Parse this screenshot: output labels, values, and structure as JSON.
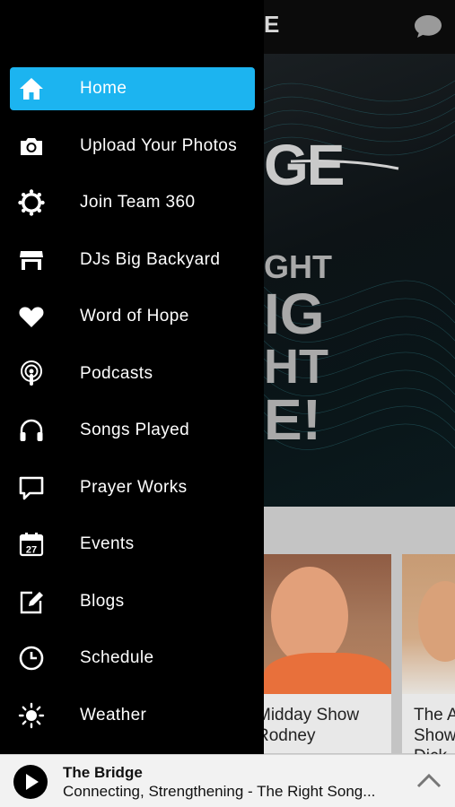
{
  "menu": {
    "items": [
      {
        "label": "Home",
        "icon": "home-icon",
        "active": true
      },
      {
        "label": "Upload Your Photos",
        "icon": "camera-icon"
      },
      {
        "label": "Join Team 360",
        "icon": "badge-icon"
      },
      {
        "label": "DJs Big Backyard",
        "icon": "storefront-icon"
      },
      {
        "label": "Word of Hope",
        "icon": "heart-icon"
      },
      {
        "label": "Podcasts",
        "icon": "podcast-icon"
      },
      {
        "label": "Songs Played",
        "icon": "headphones-icon"
      },
      {
        "label": "Prayer Works",
        "icon": "speech-bubble-icon"
      },
      {
        "label": "Events",
        "icon": "calendar-icon",
        "calendar_day": "27"
      },
      {
        "label": "Blogs",
        "icon": "edit-icon"
      },
      {
        "label": "Schedule",
        "icon": "clock-icon"
      },
      {
        "label": "Weather",
        "icon": "sun-icon"
      }
    ],
    "active_color": "#1cb4f0"
  },
  "background": {
    "logo_fragment": "E",
    "hero": {
      "logo_text": "GE",
      "lines": [
        "GHT",
        "IG",
        "HT",
        "E!"
      ]
    },
    "cards": [
      {
        "title_line1": "Midday Show",
        "title_line2": "Rodney"
      },
      {
        "title_line1": "The A",
        "title_line2": "Show",
        "title_line3": "Dick"
      }
    ]
  },
  "player": {
    "station": "The Bridge",
    "now_playing": "Connecting, Strengthening - The Right Song..."
  }
}
